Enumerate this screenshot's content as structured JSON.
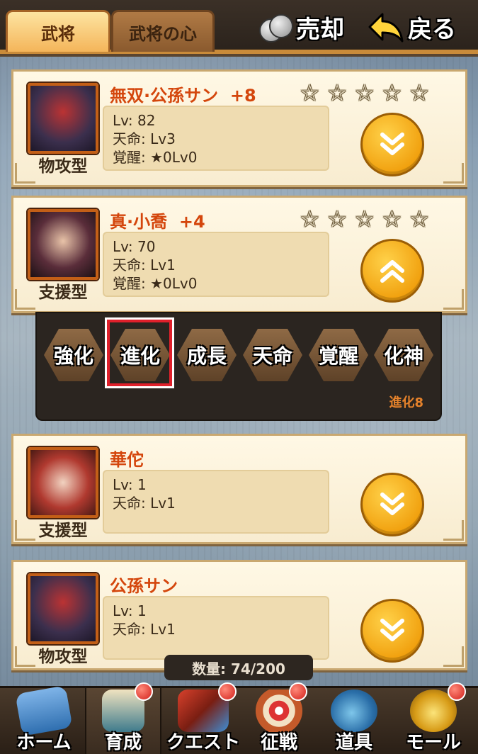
{
  "tabs": [
    {
      "label": "武将",
      "active": true
    },
    {
      "label": "武将の心",
      "active": false
    }
  ],
  "header": {
    "sell_label": "売却",
    "back_label": "戻る"
  },
  "cards": [
    {
      "name": "無双·公孫サン",
      "plus": "+8",
      "type": "物攻型",
      "stats": [
        "Lv: 82",
        "天命: Lv3",
        "覚醒: ★0Lv0"
      ],
      "stars": 5,
      "expanded": false,
      "portrait_color": "#4b3f63"
    },
    {
      "name": "真·小喬",
      "plus": "+4",
      "type": "支援型",
      "stats": [
        "Lv: 70",
        "天命: Lv1",
        "覚醒: ★0Lv0"
      ],
      "stars": 5,
      "expanded": true,
      "portrait_color": "#3f2a3a"
    },
    {
      "name": "華佗",
      "plus": "",
      "type": "支援型",
      "stats": [
        "Lv: 1",
        "天命: Lv1"
      ],
      "stars": 0,
      "expanded": false,
      "portrait_color": "#7a3a2a"
    },
    {
      "name": "公孫サン",
      "plus": "",
      "type": "物攻型",
      "stats": [
        "Lv: 1",
        "天命: Lv1"
      ],
      "stars": 0,
      "expanded": false,
      "portrait_color": "#4b3f63"
    }
  ],
  "actions": [
    "強化",
    "進化",
    "成長",
    "天命",
    "覚醒",
    "化神"
  ],
  "selected_action": "進化",
  "evolution_count": "進化8",
  "count_label": "数量: 74/200",
  "nav": [
    {
      "label": "ホーム",
      "badge": false,
      "icon": "home-icon",
      "active": false
    },
    {
      "label": "育成",
      "badge": true,
      "icon": "training-book-icon",
      "active": true
    },
    {
      "label": "クエスト",
      "badge": true,
      "icon": "quest-weapons-icon",
      "active": false
    },
    {
      "label": "征戦",
      "badge": true,
      "icon": "target-arrows-icon",
      "active": false
    },
    {
      "label": "道具",
      "badge": false,
      "icon": "item-bag-icon",
      "active": false
    },
    {
      "label": "モール",
      "badge": true,
      "icon": "coins-icon",
      "active": false
    }
  ]
}
